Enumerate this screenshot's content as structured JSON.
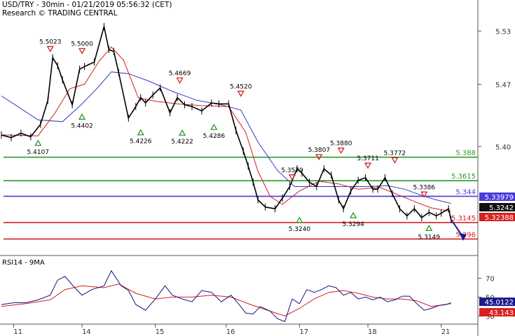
{
  "header": {
    "title": "USD/TRY - 30min - 01/21/2019 05:56:32 (CET)",
    "subtitle": "Research © TRADING CENTRAL"
  },
  "chart_data": [
    {
      "type": "line",
      "name": "price-panel",
      "ylim": [
        5.2853,
        5.5491
      ],
      "y_ticks": [
        "5.53",
        "5.47",
        "5.40"
      ],
      "x_ticks": [
        "11",
        "14",
        "15",
        "16",
        "17",
        "18",
        "21"
      ],
      "x_tick_pos": [
        0.5,
        3.3,
        6.3,
        9.2,
        12.2,
        15.0,
        18.0
      ],
      "x_range": [
        0,
        19.5
      ],
      "price": {
        "t": [
          0,
          0.4,
          0.8,
          1.2,
          1.6,
          1.9,
          2.1,
          2.3,
          2.5,
          2.9,
          3.2,
          3.4,
          3.8,
          4.2,
          4.4,
          4.6,
          4.8,
          5.2,
          5.5,
          5.7,
          5.9,
          6.2,
          6.5,
          6.9,
          7.2,
          7.5,
          7.8,
          8.2,
          8.6,
          8.9,
          9.3,
          9.6,
          9.9,
          10.1,
          10.3,
          10.5,
          10.8,
          11.2,
          11.5,
          11.8,
          12.1,
          12.3,
          12.6,
          12.9,
          13.2,
          13.5,
          13.8,
          14.0,
          14.3,
          14.6,
          14.9,
          15.2,
          15.4,
          15.7,
          16.0,
          16.3,
          16.6,
          16.9,
          17.2,
          17.5,
          17.8,
          18.0,
          18.3,
          18.4
        ],
        "v": [
          5.413,
          5.41,
          5.415,
          5.411,
          5.425,
          5.452,
          5.5,
          5.491,
          5.475,
          5.447,
          5.487,
          5.49,
          5.495,
          5.535,
          5.509,
          5.507,
          5.483,
          5.432,
          5.445,
          5.455,
          5.449,
          5.458,
          5.466,
          5.438,
          5.455,
          5.447,
          5.445,
          5.44,
          5.449,
          5.448,
          5.448,
          5.418,
          5.395,
          5.378,
          5.36,
          5.34,
          5.332,
          5.33,
          5.342,
          5.355,
          5.375,
          5.37,
          5.36,
          5.355,
          5.375,
          5.368,
          5.34,
          5.33,
          5.35,
          5.362,
          5.365,
          5.352,
          5.352,
          5.365,
          5.347,
          5.33,
          5.322,
          5.33,
          5.32,
          5.326,
          5.322,
          5.325,
          5.33,
          5.318
        ]
      },
      "ma_fast": {
        "t": [
          0,
          1.5,
          2.2,
          2.8,
          3.4,
          4.0,
          4.5,
          5.0,
          5.6,
          6.3,
          7.2,
          8.2,
          9.3,
          10.0,
          10.5,
          11.0,
          11.5,
          12.2,
          13.0,
          13.8,
          14.6,
          15.5,
          16.3,
          17.0,
          17.6,
          18.4
        ],
        "v": [
          5.413,
          5.412,
          5.438,
          5.465,
          5.47,
          5.496,
          5.512,
          5.497,
          5.455,
          5.451,
          5.448,
          5.446,
          5.445,
          5.416,
          5.372,
          5.344,
          5.335,
          5.35,
          5.361,
          5.358,
          5.352,
          5.354,
          5.345,
          5.337,
          5.331,
          5.327
        ]
      },
      "ma_slow": {
        "t": [
          0,
          1.5,
          2.5,
          3.3,
          4.0,
          4.5,
          5.2,
          6.0,
          7.0,
          8.0,
          9.0,
          9.8,
          10.5,
          11.3,
          12.0,
          13.0,
          14.0,
          15.0,
          15.8,
          16.5,
          17.2,
          17.8,
          18.4
        ],
        "v": [
          5.457,
          5.43,
          5.428,
          5.448,
          5.468,
          5.484,
          5.482,
          5.474,
          5.462,
          5.452,
          5.447,
          5.441,
          5.405,
          5.373,
          5.355,
          5.355,
          5.355,
          5.355,
          5.356,
          5.352,
          5.345,
          5.34,
          5.336
        ]
      },
      "levels": [
        {
          "value": 5.388,
          "label": "5.388",
          "color": "#2a9a2a"
        },
        {
          "value": 5.3615,
          "label": "5.3615",
          "color": "#2a9a2a"
        },
        {
          "value": 5.344,
          "label": "5.344",
          "color": "#4a3ad8"
        },
        {
          "value": 5.3145,
          "label": "5.3145",
          "color": "#d82020"
        },
        {
          "value": 5.296,
          "label": "5.296",
          "color": "#d82020"
        }
      ],
      "current_price_badges": [
        {
          "value": 5.33979,
          "label": "5.33979",
          "bg": "#4a3ad8"
        },
        {
          "value": 5.3242,
          "label": "5.3242",
          "bg": "#111111"
        },
        {
          "value": 5.32388,
          "label": "5.32388",
          "bg": "#d82020"
        }
      ],
      "highs": [
        {
          "t": 2.0,
          "value": 5.5023,
          "label": "5.5023"
        },
        {
          "t": 3.3,
          "value": 5.5,
          "label": "5.5000"
        },
        {
          "t": 7.3,
          "value": 5.4669,
          "label": "5.4669"
        },
        {
          "t": 9.8,
          "value": 5.452,
          "label": "5.4520"
        },
        {
          "t": 11.9,
          "value": 5.3579,
          "label": "5.3579"
        },
        {
          "t": 13.0,
          "value": 5.3807,
          "label": "5.3807"
        },
        {
          "t": 13.9,
          "value": 5.388,
          "label": "5.3880"
        },
        {
          "t": 15.0,
          "value": 5.3711,
          "label": "5.3711"
        },
        {
          "t": 16.1,
          "value": 5.3772,
          "label": "5.3772"
        },
        {
          "t": 17.3,
          "value": 5.3386,
          "label": "5.3386"
        }
      ],
      "lows": [
        {
          "t": 1.5,
          "value": 5.4107,
          "label": "5.4107"
        },
        {
          "t": 3.3,
          "value": 5.4402,
          "label": "5.4402"
        },
        {
          "t": 5.7,
          "value": 5.4226,
          "label": "5.4226"
        },
        {
          "t": 7.4,
          "value": 5.4222,
          "label": "5.4222"
        },
        {
          "t": 8.7,
          "value": 5.4286,
          "label": "5.4286"
        },
        {
          "t": 12.2,
          "value": 5.324,
          "label": "5.3240"
        },
        {
          "t": 14.4,
          "value": 5.3294,
          "label": "5.3294"
        },
        {
          "t": 17.5,
          "value": 5.3149,
          "label": "5.3149"
        }
      ],
      "forecast_arrow": {
        "from": [
          18.4,
          5.318
        ],
        "to": [
          18.9,
          5.298
        ]
      }
    },
    {
      "type": "line",
      "name": "RSI14 - 9MA",
      "title": "RSI14 - 9MA",
      "ylim": [
        22,
        92
      ],
      "y_ticks": [
        "70",
        "50",
        "30"
      ],
      "rsi": {
        "t": [
          0,
          0.5,
          1.0,
          1.5,
          2.0,
          2.3,
          2.6,
          3.0,
          3.3,
          3.7,
          4.2,
          4.5,
          4.9,
          5.2,
          5.5,
          5.9,
          6.3,
          6.7,
          7.0,
          7.4,
          7.8,
          8.2,
          8.6,
          9.0,
          9.4,
          9.7,
          10.0,
          10.3,
          10.6,
          11.0,
          11.3,
          11.6,
          11.9,
          12.2,
          12.5,
          12.8,
          13.1,
          13.4,
          13.7,
          14.0,
          14.3,
          14.6,
          14.9,
          15.2,
          15.5,
          15.8,
          16.1,
          16.4,
          16.7,
          17.0,
          17.3,
          17.6,
          17.9,
          18.2,
          18.4
        ],
        "v": [
          42,
          44,
          44,
          47,
          52,
          68,
          72,
          60,
          52,
          58,
          62,
          78,
          62,
          57,
          42,
          36,
          48,
          62,
          52,
          48,
          45,
          57,
          55,
          45,
          52,
          43,
          33,
          32,
          40,
          35,
          27,
          24,
          48,
          43,
          58,
          55,
          58,
          62,
          60,
          52,
          55,
          48,
          50,
          47,
          50,
          45,
          47,
          51,
          51,
          43,
          36,
          38,
          41,
          42,
          44
        ]
      },
      "rsi_ma": {
        "t": [
          0,
          1.0,
          2.0,
          2.6,
          3.3,
          4.2,
          4.8,
          5.5,
          6.3,
          7.0,
          7.8,
          8.6,
          9.4,
          10.2,
          11.0,
          11.6,
          12.2,
          12.8,
          13.4,
          14.0,
          14.6,
          15.2,
          15.8,
          16.4,
          17.0,
          17.6,
          18.4
        ],
        "v": [
          40,
          43,
          47,
          58,
          62,
          60,
          64,
          54,
          48,
          50,
          50,
          52,
          50,
          42,
          35,
          30,
          38,
          48,
          55,
          57,
          54,
          50,
          48,
          48,
          46,
          40,
          43
        ]
      },
      "value_badges": [
        {
          "value": 45.0122,
          "label": "45.0122",
          "bg": "#1a1a8a"
        },
        {
          "value": 43.143,
          "label": "43.143",
          "bg": "#d82020"
        }
      ]
    }
  ]
}
